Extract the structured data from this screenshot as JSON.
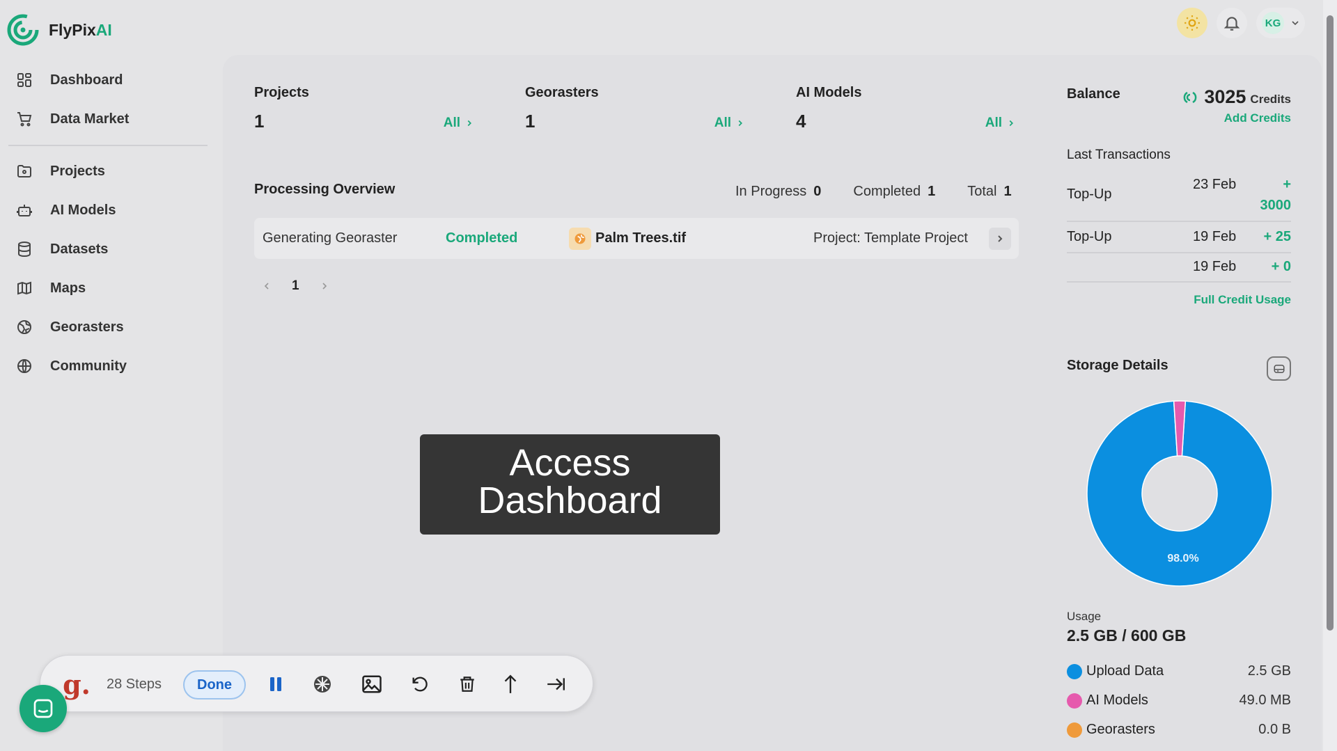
{
  "brand": {
    "name": "FlyPix",
    "suffix": "AI"
  },
  "topbar": {
    "user_initials": "KG"
  },
  "sidebar": {
    "items": [
      {
        "label": "Dashboard",
        "icon": "dashboard-icon"
      },
      {
        "label": "Data Market",
        "icon": "cart-icon"
      },
      {
        "label": "Projects",
        "icon": "folder-icon"
      },
      {
        "label": "AI Models",
        "icon": "robot-icon"
      },
      {
        "label": "Datasets",
        "icon": "database-icon"
      },
      {
        "label": "Maps",
        "icon": "map-icon"
      },
      {
        "label": "Georasters",
        "icon": "globe-grid-icon"
      },
      {
        "label": "Community",
        "icon": "globe-icon"
      }
    ]
  },
  "stats": [
    {
      "label": "Projects",
      "value": "1",
      "link": "All"
    },
    {
      "label": "Georasters",
      "value": "1",
      "link": "All"
    },
    {
      "label": "AI Models",
      "value": "4",
      "link": "All"
    }
  ],
  "processing": {
    "title": "Processing Overview",
    "in_progress_label": "In Progress",
    "in_progress": "0",
    "completed_label": "Completed",
    "completed": "1",
    "total_label": "Total",
    "total": "1",
    "row": {
      "task": "Generating Georaster",
      "status": "Completed",
      "file": "Palm Trees.tif",
      "project": "Project: Template Project"
    },
    "page": "1"
  },
  "overlay": {
    "line1": "Access",
    "line2": "Dashboard"
  },
  "balance": {
    "title": "Balance",
    "amount": "3025",
    "unit": "Credits",
    "add_label": "Add Credits",
    "transactions_title": "Last Transactions",
    "transactions": [
      {
        "type": "Top-Up",
        "date": "23 Feb",
        "sign": "+",
        "amount": "3000"
      },
      {
        "type": "Top-Up",
        "date": "19 Feb",
        "amount": "+ 25"
      },
      {
        "type": "",
        "date": "19 Feb",
        "amount": "+ 0"
      }
    ],
    "full_usage_label": "Full Credit Usage"
  },
  "storage": {
    "title": "Storage Details",
    "usage_label": "Usage",
    "usage_value": "2.5 GB / 600 GB",
    "colors": {
      "upload": "#0b8fe0",
      "ai_models": "#e65aad",
      "georasters": "#ef9a3b"
    },
    "legend": [
      {
        "label": "Upload Data",
        "value": "2.5 GB"
      },
      {
        "label": "AI Models",
        "value": "49.0 MB"
      },
      {
        "label": "Georasters",
        "value": "0.0 B"
      }
    ]
  },
  "chart_data": {
    "type": "pie",
    "categories": [
      "Upload Data",
      "AI Models",
      "Georasters"
    ],
    "values": [
      98.0,
      2.0,
      0.0
    ],
    "data_labels": [
      "98.0%"
    ]
  },
  "toolbar": {
    "steps": "28 Steps",
    "done_label": "Done"
  }
}
